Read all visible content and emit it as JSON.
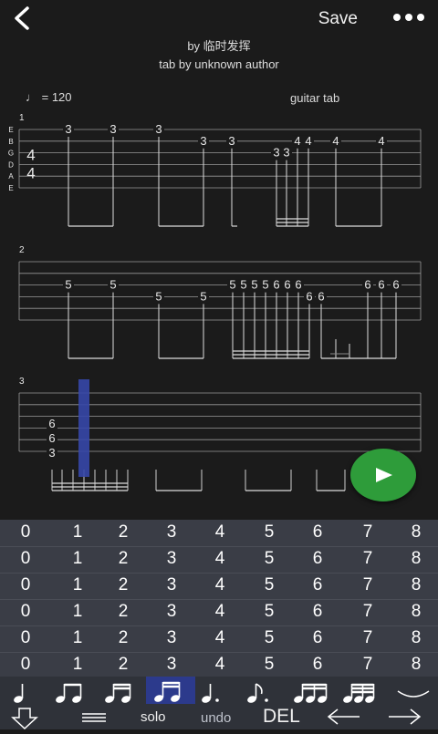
{
  "header": {
    "save_label": "Save",
    "author_line": "by 临时发挥",
    "tab_credit": "tab by unknown author",
    "tempo": "= 120",
    "tab_type": "guitar tab"
  },
  "score": {
    "string_names": [
      "E",
      "B",
      "G",
      "D",
      "A",
      "E"
    ],
    "time_signature": [
      "4",
      "4"
    ],
    "measures": [
      {
        "number": "1",
        "notes": [
          {
            "string": 1,
            "fret": "3"
          },
          {
            "string": 1,
            "fret": "3"
          },
          {
            "string": 1,
            "fret": "3"
          },
          {
            "string": 2,
            "fret": "3"
          },
          {
            "string": 2,
            "fret": "3"
          },
          {
            "string": 3,
            "fret": "3"
          },
          {
            "string": 3,
            "fret": "3"
          },
          {
            "string": 2,
            "fret": "4"
          },
          {
            "string": 2,
            "fret": "4"
          },
          {
            "string": 2,
            "fret": "4"
          },
          {
            "string": 2,
            "fret": "4"
          }
        ]
      },
      {
        "number": "2",
        "notes": [
          {
            "string": 3,
            "fret": "5"
          },
          {
            "string": 3,
            "fret": "5"
          },
          {
            "string": 4,
            "fret": "5"
          },
          {
            "string": 4,
            "fret": "5"
          },
          {
            "string": 3,
            "fret": "5"
          },
          {
            "string": 3,
            "fret": "5"
          },
          {
            "string": 3,
            "fret": "5"
          },
          {
            "string": 3,
            "fret": "5"
          },
          {
            "string": 3,
            "fret": "6"
          },
          {
            "string": 3,
            "fret": "6"
          },
          {
            "string": 3,
            "fret": "6"
          },
          {
            "string": 4,
            "fret": "6"
          },
          {
            "string": 4,
            "fret": "6"
          },
          {
            "string": 3,
            "fret": "6"
          },
          {
            "string": 3,
            "fret": "6"
          },
          {
            "string": 3,
            "fret": "6"
          }
        ]
      },
      {
        "number": "3",
        "notes": [
          {
            "string": 3,
            "fret": "6"
          },
          {
            "string": 4,
            "fret": "6"
          },
          {
            "string": 5,
            "fret": "3"
          }
        ]
      }
    ]
  },
  "keypad": {
    "rows": [
      [
        "0",
        "1",
        "2",
        "3",
        "4",
        "5",
        "6",
        "7",
        "8"
      ],
      [
        "0",
        "1",
        "2",
        "3",
        "4",
        "5",
        "6",
        "7",
        "8"
      ],
      [
        "0",
        "1",
        "2",
        "3",
        "4",
        "5",
        "6",
        "7",
        "8"
      ],
      [
        "0",
        "1",
        "2",
        "3",
        "4",
        "5",
        "6",
        "7",
        "8"
      ],
      [
        "0",
        "1",
        "2",
        "3",
        "4",
        "5",
        "6",
        "7",
        "8"
      ],
      [
        "0",
        "1",
        "2",
        "3",
        "4",
        "5",
        "6",
        "7",
        "8"
      ]
    ]
  },
  "toolbar": {
    "durations": [
      "quarter-note-icon",
      "eighth-pair-icon",
      "eighth-pair-icon",
      "sixteenth-pair-icon",
      "dotted-quarter-icon",
      "dotted-eighth-icon",
      "sixteenth-triplet-icon",
      "sixteenth-group-icon",
      "tie-icon"
    ],
    "solo_label": "solo",
    "undo_label": "undo",
    "del_label": "DEL"
  },
  "colors": {
    "background": "#1b1b1b",
    "keypad": "#3a3d46",
    "play_button": "#2e9c3a",
    "cursor": "#3647a8",
    "selected_tool": "#2c3a8c"
  }
}
